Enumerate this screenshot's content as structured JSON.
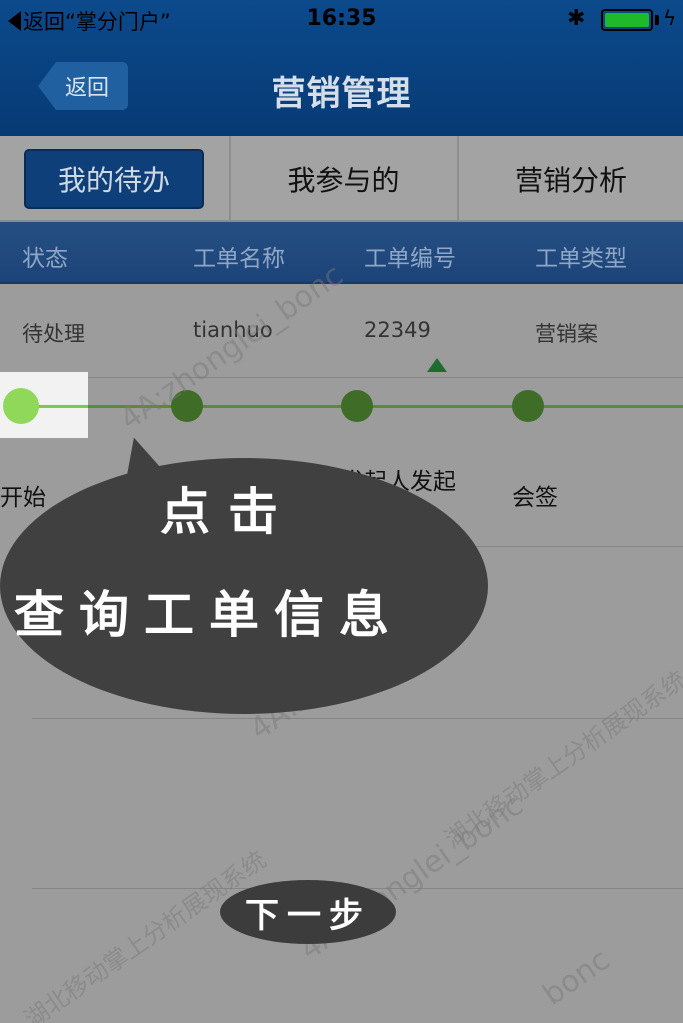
{
  "status_bar": {
    "back_app": "返回“掌分门户”",
    "time": "16:35",
    "bluetooth": "bluetooth-icon",
    "battery_level": 1.0
  },
  "nav": {
    "back_label": "返回",
    "title": "营销管理"
  },
  "segments": [
    {
      "label": "我的待办",
      "active": true
    },
    {
      "label": "我参与的",
      "active": false
    },
    {
      "label": "营销分析",
      "active": false
    }
  ],
  "table": {
    "headers": [
      "状态",
      "工单名称",
      "工单编号",
      "工单类型"
    ],
    "rows": [
      [
        "待处理",
        "tianhuo",
        "22349",
        "营销案"
      ]
    ]
  },
  "progress": {
    "steps": [
      "开始",
      "发起人发起",
      "会签"
    ],
    "current_step": 0
  },
  "overlay": {
    "line1": "点击",
    "line2": "查询工单信息",
    "next_label": "下一步"
  },
  "watermark": {
    "texts": [
      "4A:zhonglei_bonc",
      "湖北移动掌上分析展现系统",
      "bonc"
    ]
  },
  "colors": {
    "nav_bg": "#0c4a8c",
    "active_segment": "#0f3f78",
    "step_done": "#8fd85a",
    "step_pending": "#3f6d28"
  }
}
